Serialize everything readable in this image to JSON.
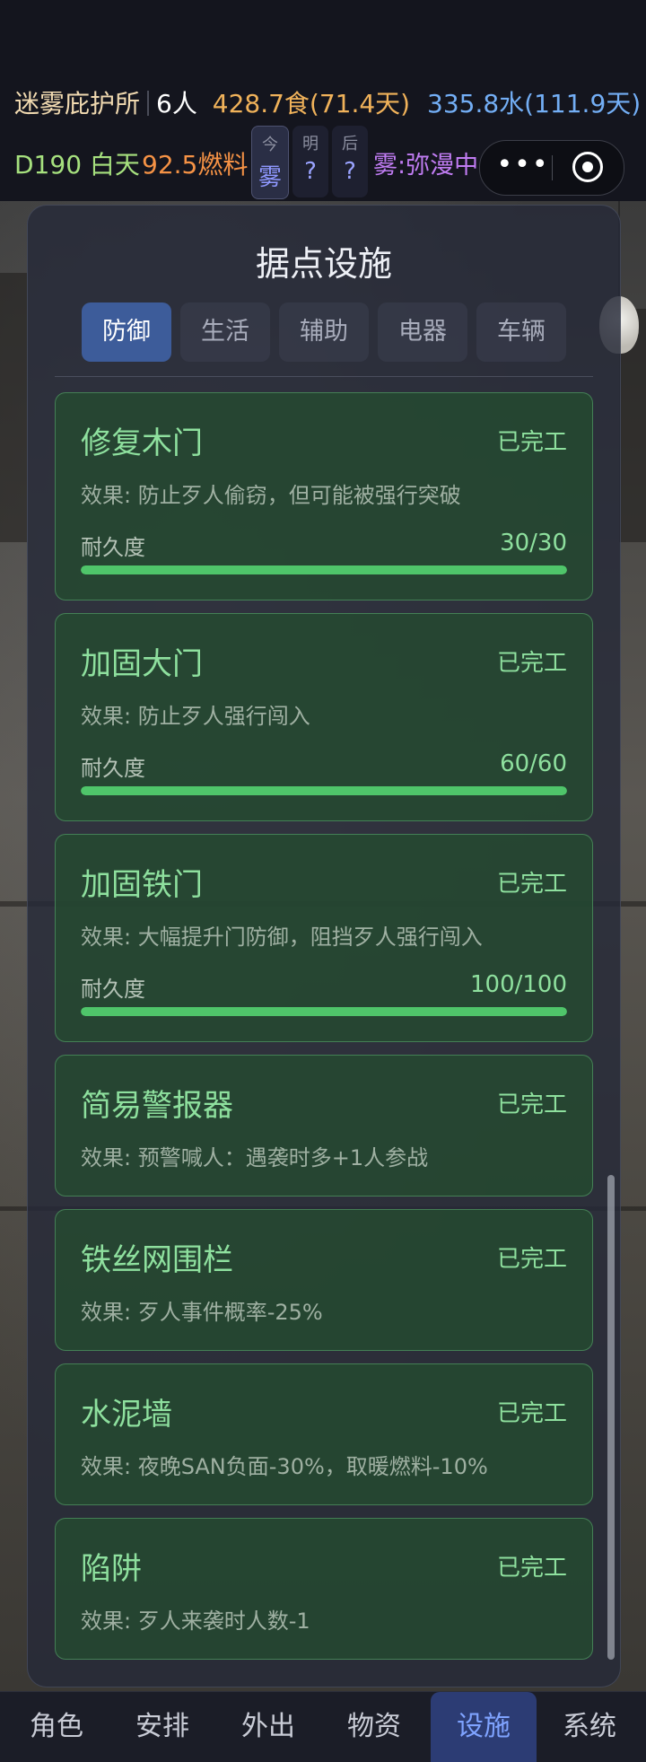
{
  "header": {
    "shelter_name": "迷雾庇护所",
    "people": "6人",
    "food": "428.7食(71.4天)",
    "water": "335.8水(111.9天)",
    "day": "D190 白天",
    "fuel": "92.5燃料",
    "weather": {
      "today_label": "今",
      "today_value": "雾",
      "tomorrow_label": "明",
      "tomorrow_value": "?",
      "after_label": "后",
      "after_value": "?"
    },
    "fog_status": "雾:弥漫中",
    "capsule_dots": "•••"
  },
  "panel": {
    "title": "据点设施",
    "tabs": [
      "防御",
      "生活",
      "辅助",
      "电器",
      "车辆"
    ],
    "active_tab": "防御"
  },
  "facilities": [
    {
      "name": "修复木门",
      "status": "已完工",
      "effect": "效果: 防止歹人偷窃，但可能被强行突破",
      "durability_label": "耐久度",
      "durability": "30/30",
      "durability_ratio": 1.0
    },
    {
      "name": "加固大门",
      "status": "已完工",
      "effect": "效果: 防止歹人强行闯入",
      "durability_label": "耐久度",
      "durability": "60/60",
      "durability_ratio": 1.0
    },
    {
      "name": "加固铁门",
      "status": "已完工",
      "effect": "效果: 大幅提升门防御，阻挡歹人强行闯入",
      "durability_label": "耐久度",
      "durability": "100/100",
      "durability_ratio": 1.0
    },
    {
      "name": "简易警报器",
      "status": "已完工",
      "effect": "效果: 预警喊人：遇袭时多+1人参战"
    },
    {
      "name": "铁丝网围栏",
      "status": "已完工",
      "effect": "效果: 歹人事件概率-25%"
    },
    {
      "name": "水泥墙",
      "status": "已完工",
      "effect": "效果: 夜晚SAN负面-30%，取暖燃料-10%"
    },
    {
      "name": "陷阱",
      "status": "已完工",
      "effect": "效果: 歹人来袭时人数-1"
    }
  ],
  "bottom_nav": {
    "items": [
      "角色",
      "安排",
      "外出",
      "物资",
      "设施",
      "系统"
    ],
    "active": "设施"
  },
  "colors": {
    "accent": "#3d5c9a",
    "card_green": "#8ee09e",
    "bar_fill": "#4fc56a",
    "nav_active": "#7fa3ff"
  }
}
